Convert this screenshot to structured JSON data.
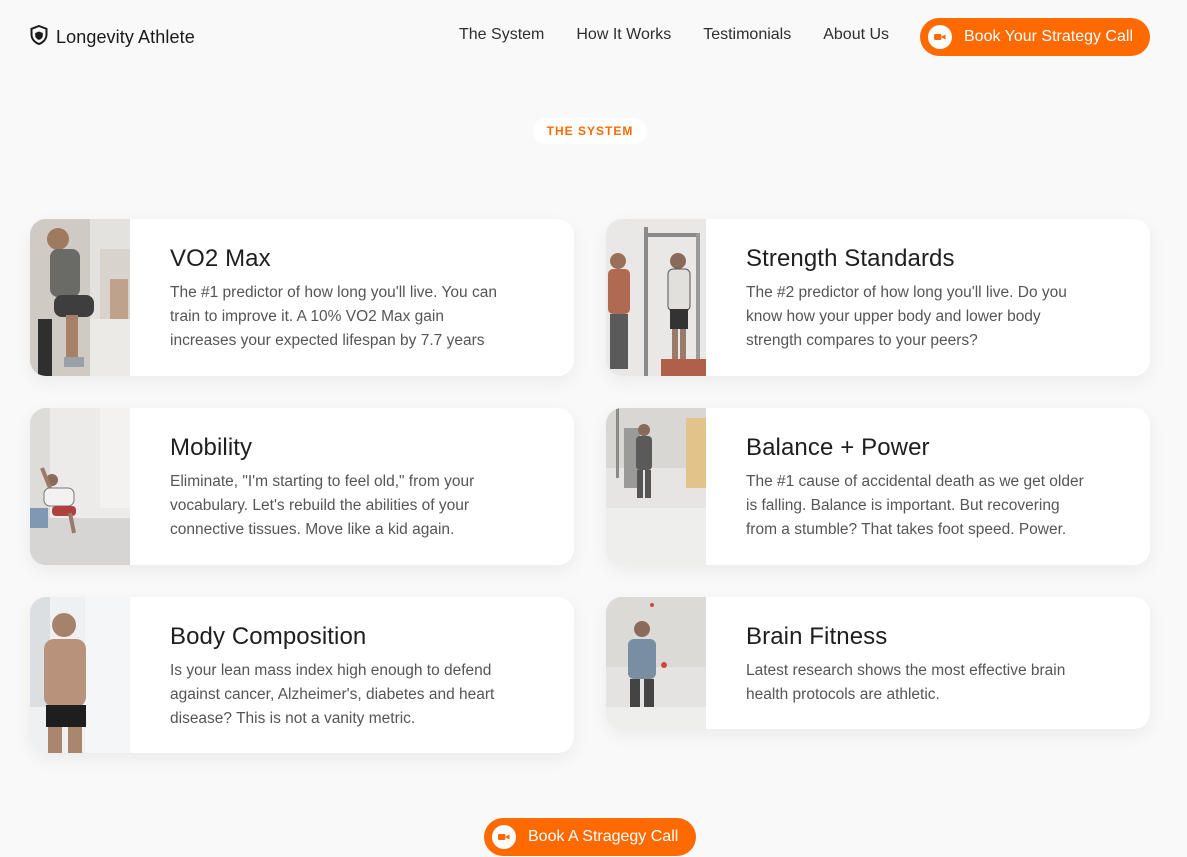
{
  "header": {
    "logo_text": "Longevity Athlete",
    "logo_icon": "shield-icon",
    "nav": [
      "The System",
      "How It Works",
      "Testimonials",
      "About Us"
    ],
    "cta_label": "Book Your Strategy Call",
    "cta_icon": "video-camera-icon"
  },
  "section": {
    "tag": "THE SYSTEM"
  },
  "cards": [
    {
      "title": "VO2 Max",
      "description": "The #1 predictor of how long you'll live. You can train to improve it. A 10% VO2 Max gain increases your expected lifespan by 7.7 years"
    },
    {
      "title": "Strength Standards",
      "description": "The #2 predictor of how long you'll live. Do you know how your upper body and lower body strength compares to your peers?"
    },
    {
      "title": "Mobility",
      "description": "Eliminate, \"I'm starting to feel old,\" from your vocabulary. Let's rebuild the abilities of your connective tissues. Move like a kid again."
    },
    {
      "title": "Balance + Power",
      "description": "The #1 cause of accidental death as we get older is falling. Balance is important. But recovering from a stumble? That takes foot speed. Power."
    },
    {
      "title": "Body Composition",
      "description": "Is your lean mass index high enough to defend against cancer, Alzheimer's, diabetes and heart disease? This is not a vanity metric."
    },
    {
      "title": "Brain Fitness",
      "description": "Latest research shows the most effective brain health protocols are athletic."
    }
  ],
  "footer_cta": {
    "label": "Book A Stragegy Call",
    "icon": "video-camera-icon"
  },
  "colors": {
    "accent": "#ff6a00",
    "background": "#f9f9f9",
    "card": "#ffffff",
    "text": "#1e1e1e",
    "muted_text": "#555555"
  }
}
